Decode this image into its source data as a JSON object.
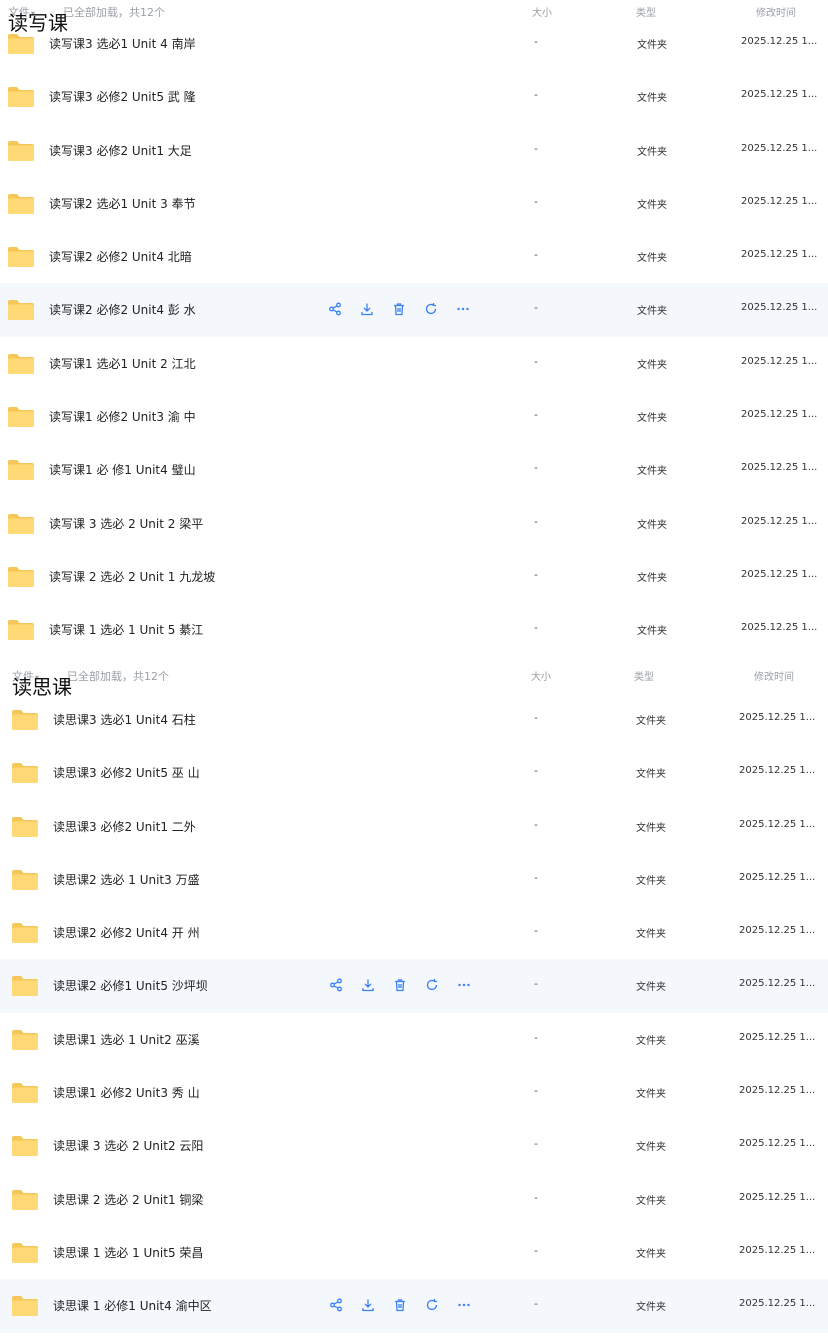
{
  "columns": {
    "file": "文件",
    "loaded": "已全部加载，共12个",
    "size": "大小",
    "type": "类型",
    "mtime": "修改时间"
  },
  "icons": {
    "folder": "folder-icon",
    "share": "share-icon",
    "download": "download-icon",
    "delete": "trash-icon",
    "restore": "refresh-icon",
    "more": "more-icon",
    "sort": "sort-down-arrow"
  },
  "colors": {
    "folder": "#ffd36b",
    "accent": "#3b82f6",
    "hover_bg": "#f4f7fc"
  },
  "sections": [
    {
      "title": "读写课",
      "rows": [
        {
          "name": "读写课3 选必1 Unit 4 南岸",
          "size": "-",
          "type": "文件夹",
          "mtime": "2025.12.25 1..."
        },
        {
          "name": "读写课3 必修2 Unit5 武 隆",
          "size": "-",
          "type": "文件夹",
          "mtime": "2025.12.25 1..."
        },
        {
          "name": "读写课3 必修2 Unit1 大足",
          "size": "-",
          "type": "文件夹",
          "mtime": "2025.12.25 1..."
        },
        {
          "name": "读写课2 选必1 Unit 3 奉节",
          "size": "-",
          "type": "文件夹",
          "mtime": "2025.12.25 1..."
        },
        {
          "name": "读写课2 必修2 Unit4 北暗",
          "size": "-",
          "type": "文件夹",
          "mtime": "2025.12.25 1..."
        },
        {
          "name": "读写课2 必修2 Unit4 彭 水",
          "size": "-",
          "type": "文件夹",
          "mtime": "2025.12.25 1...",
          "hover": true
        },
        {
          "name": "读写课1 选必1 Unit 2 江北",
          "size": "-",
          "type": "文件夹",
          "mtime": "2025.12.25 1..."
        },
        {
          "name": "读写课1 必修2 Unit3 渝 中",
          "size": "-",
          "type": "文件夹",
          "mtime": "2025.12.25 1..."
        },
        {
          "name": "读写课1 必 修1 Unit4 璧山",
          "size": "-",
          "type": "文件夹",
          "mtime": "2025.12.25 1..."
        },
        {
          "name": "读写课 3 选必 2 Unit 2 梁平",
          "size": "-",
          "type": "文件夹",
          "mtime": "2025.12.25 1..."
        },
        {
          "name": "读写课 2 选必 2 Unit 1 九龙坡",
          "size": "-",
          "type": "文件夹",
          "mtime": "2025.12.25 1..."
        },
        {
          "name": "读写课 1 选必 1 Unit 5 綦江",
          "size": "-",
          "type": "文件夹",
          "mtime": "2025.12.25 1..."
        }
      ]
    },
    {
      "title": "读思课",
      "rows": [
        {
          "name": "读思课3 选必1 Unit4 石柱",
          "size": "-",
          "type": "文件夹",
          "mtime": "2025.12.25 1..."
        },
        {
          "name": "读思课3 必修2 Unit5 巫 山",
          "size": "-",
          "type": "文件夹",
          "mtime": "2025.12.25 1..."
        },
        {
          "name": "读思课3 必修2 Unit1 二外",
          "size": "-",
          "type": "文件夹",
          "mtime": "2025.12.25 1..."
        },
        {
          "name": "读思课2 选必 1 Unit3 万盛",
          "size": "-",
          "type": "文件夹",
          "mtime": "2025.12.25 1..."
        },
        {
          "name": "读思课2 必修2 Unit4 开 州",
          "size": "-",
          "type": "文件夹",
          "mtime": "2025.12.25 1..."
        },
        {
          "name": "读思课2 必修1 Unit5 沙坪坝",
          "size": "-",
          "type": "文件夹",
          "mtime": "2025.12.25 1...",
          "hover": true
        },
        {
          "name": "读思课1 选必 1 Unit2 巫溪",
          "size": "-",
          "type": "文件夹",
          "mtime": "2025.12.25 1..."
        },
        {
          "name": "读思课1 必修2 Unit3 秀 山",
          "size": "-",
          "type": "文件夹",
          "mtime": "2025.12.25 1..."
        },
        {
          "name": "读思课 3 选必 2 Unit2 云阳",
          "size": "-",
          "type": "文件夹",
          "mtime": "2025.12.25 1..."
        },
        {
          "name": "读思课 2 选必 2 Unit1 铜梁",
          "size": "-",
          "type": "文件夹",
          "mtime": "2025.12.25 1..."
        },
        {
          "name": "读思课 1 选必 1 Unit5 荣昌",
          "size": "-",
          "type": "文件夹",
          "mtime": "2025.12.25 1..."
        },
        {
          "name": "读思课 1 必修1 Unit4 渝中区",
          "size": "-",
          "type": "文件夹",
          "mtime": "2025.12.25 1...",
          "hover": true
        }
      ]
    }
  ]
}
